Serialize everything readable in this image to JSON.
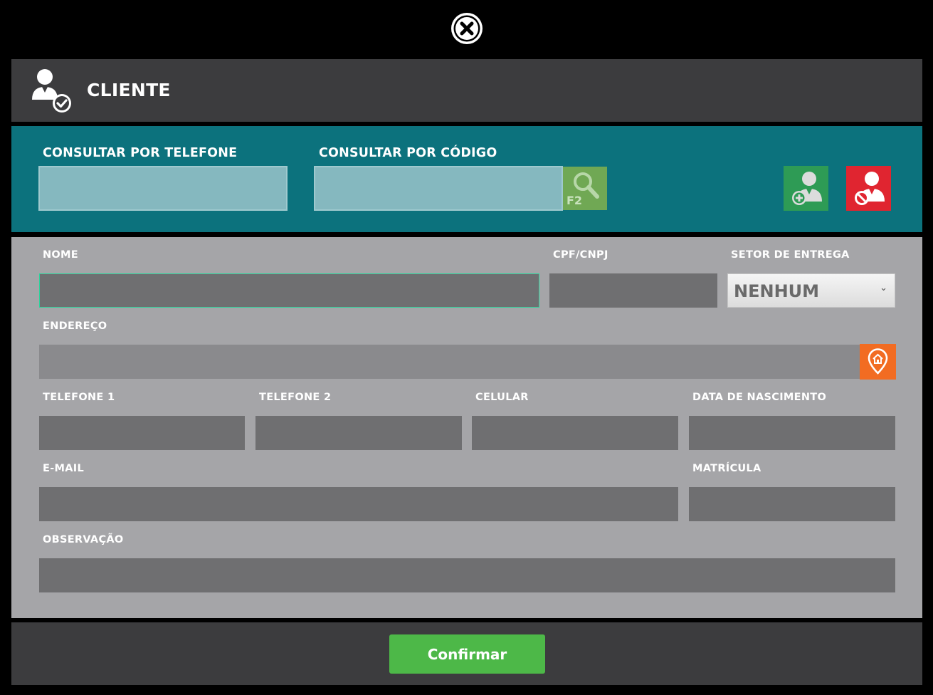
{
  "close": {
    "icon": "close-icon"
  },
  "header": {
    "title": "CLIENTE",
    "icon": "client-check-icon"
  },
  "search": {
    "phone_label": "CONSULTAR POR TELEFONE",
    "phone_value": "",
    "code_label": "CONSULTAR POR CÓDIGO",
    "code_value": "",
    "search_button_key": "F2",
    "search_icon": "magnifier-icon",
    "add_icon": "add-client-icon",
    "block_icon": "block-client-icon"
  },
  "form": {
    "nome_label": "NOME",
    "cpf_label": "CPF/CNPJ",
    "setor_label": "SETOR DE ENTREGA",
    "setor_value": "NENHUM",
    "endereco_label": "ENDEREÇO",
    "telefone1_label": "TELEFONE 1",
    "telefone2_label": "TELEFONE 2",
    "celular_label": "CELULAR",
    "nascimento_label": "DATA DE NASCIMENTO",
    "email_label": "E-MAIL",
    "matricula_label": "MATRÍCULA",
    "observacao_label": "OBSERVAÇÃO",
    "map_icon": "map-pin-home-icon"
  },
  "footer": {
    "confirm_label": "Confirmar"
  },
  "colors": {
    "header_bg": "#3c3c3e",
    "search_bg": "#0c727d",
    "form_bg": "#a5a5a8",
    "confirm": "#4db848",
    "add": "#2e9b55",
    "block": "#e02530",
    "map": "#f26c22"
  }
}
